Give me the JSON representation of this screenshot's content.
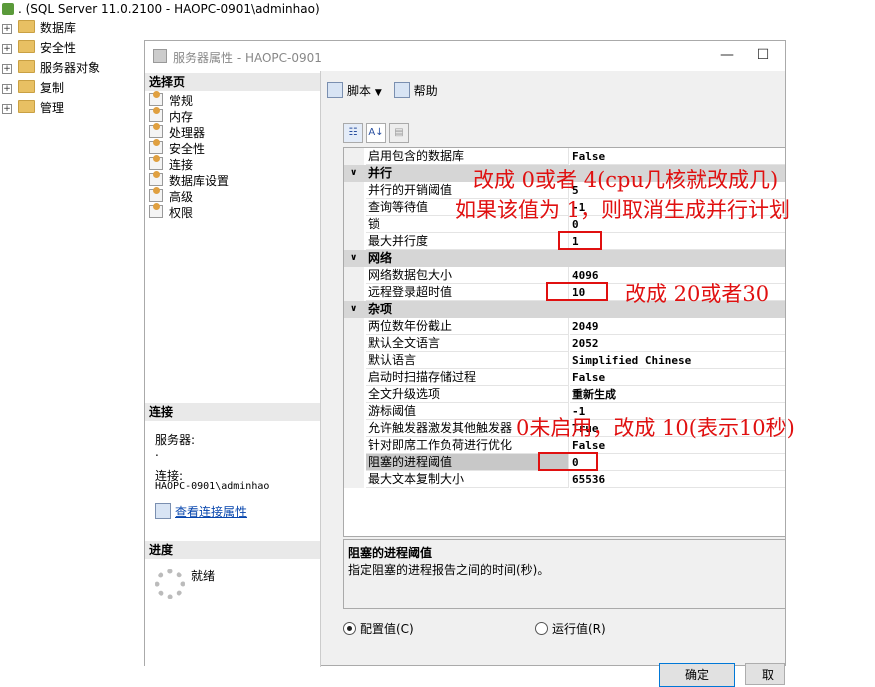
{
  "object_explorer": {
    "server_title": ". (SQL Server 11.0.2100 - HAOPC-0901\\adminhao)",
    "nodes": [
      {
        "label": "数据库"
      },
      {
        "label": "安全性"
      },
      {
        "label": "服务器对象"
      },
      {
        "label": "复制"
      },
      {
        "label": "管理"
      }
    ]
  },
  "dialog": {
    "title": "服务器属性 - HAOPC-0901",
    "select_page_header": "选择页",
    "pages": [
      "常规",
      "内存",
      "处理器",
      "安全性",
      "连接",
      "数据库设置",
      "高级",
      "权限"
    ],
    "connection": {
      "header": "连接",
      "server_label": "服务器:",
      "server_value": ".",
      "conn_label": "连接:",
      "conn_value": "HAOPC-0901\\adminhao",
      "view_link": "查看连接属性"
    },
    "progress": {
      "header": "进度",
      "status": "就绪"
    },
    "toolbar": {
      "script": "脚本",
      "help": "帮助"
    },
    "grid": {
      "top_row": {
        "name": "启用包含的数据库",
        "value": "False"
      },
      "cat_parallel": "并行",
      "parallel_rows": [
        {
          "name": "并行的开销阈值",
          "value": "5"
        },
        {
          "name": "查询等待值",
          "value": "-1"
        },
        {
          "name": "锁",
          "value": "0"
        },
        {
          "name": "最大并行度",
          "value": "1"
        }
      ],
      "cat_network": "网络",
      "network_rows": [
        {
          "name": "网络数据包大小",
          "value": "4096"
        },
        {
          "name": "远程登录超时值",
          "value": "10"
        }
      ],
      "cat_misc": "杂项",
      "misc_rows": [
        {
          "name": "两位数年份截止",
          "value": "2049"
        },
        {
          "name": "默认全文语言",
          "value": "2052"
        },
        {
          "name": "默认语言",
          "value": "Simplified Chinese"
        },
        {
          "name": "启动时扫描存储过程",
          "value": "False"
        },
        {
          "name": "全文升级选项",
          "value": "重新生成"
        },
        {
          "name": "游标阈值",
          "value": "-1"
        },
        {
          "name": "允许触发器激发其他触发器",
          "value": "True"
        },
        {
          "name": "针对即席工作负荷进行优化",
          "value": "False"
        },
        {
          "name": "阻塞的进程阈值",
          "value": "0"
        },
        {
          "name": "最大文本复制大小",
          "value": "65536"
        }
      ]
    },
    "description": {
      "title": "阻塞的进程阈值",
      "text": "指定阻塞的进程报告之间的时间(秒)。"
    },
    "radios": {
      "configured": "配置值(C)",
      "running": "运行值(R)"
    },
    "buttons": {
      "ok": "确定",
      "cancel": "取消"
    }
  },
  "annotations": {
    "a1": "改成 0或者 4(cpu几核就改成几)",
    "a2": "如果该值为 1，则取消生成并行计划",
    "a3": "改成 20或者30",
    "a4": "0未启用，改成 10(表示10秒)"
  },
  "colors": {
    "annotation_red": "#e01010",
    "category_bg": "#d6d6d6",
    "primary_border": "#0078d7"
  }
}
